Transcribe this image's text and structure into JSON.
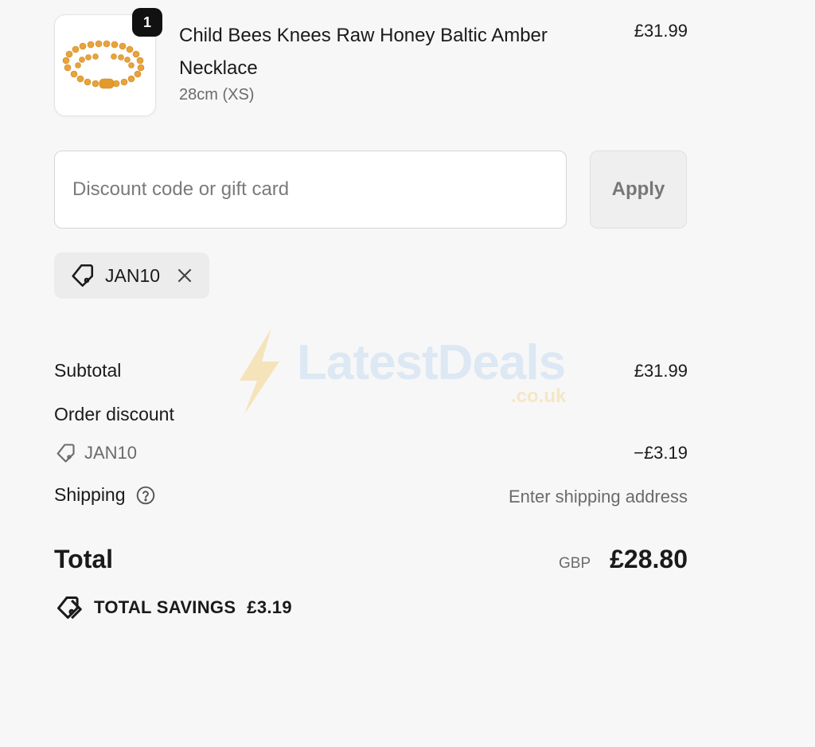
{
  "product": {
    "quantity": "1",
    "name": "Child Bees Knees Raw Honey Baltic Amber Necklace",
    "variant": "28cm (XS)",
    "price": "£31.99",
    "image_icon": "amber-necklace-image"
  },
  "discount": {
    "placeholder": "Discount code or gift card",
    "value": "",
    "apply_label": "Apply",
    "applied_code": "JAN10"
  },
  "summary": {
    "subtotal_label": "Subtotal",
    "subtotal_value": "£31.99",
    "order_discount_label": "Order discount",
    "discount_code": "JAN10",
    "discount_value": "−£3.19",
    "shipping_label": "Shipping",
    "shipping_value": "Enter shipping address",
    "total_label": "Total",
    "currency": "GBP",
    "total_value": "£28.80",
    "savings_label": "TOTAL SAVINGS",
    "savings_value": "£3.19"
  },
  "watermark": {
    "brand": "LatestDeals",
    "domain": ".co.uk"
  },
  "colors": {
    "background": "#f7f7f7",
    "text": "#1a1a1a",
    "muted": "#6b6b6b",
    "badge": "#111111",
    "amber": "#e8a33a"
  }
}
